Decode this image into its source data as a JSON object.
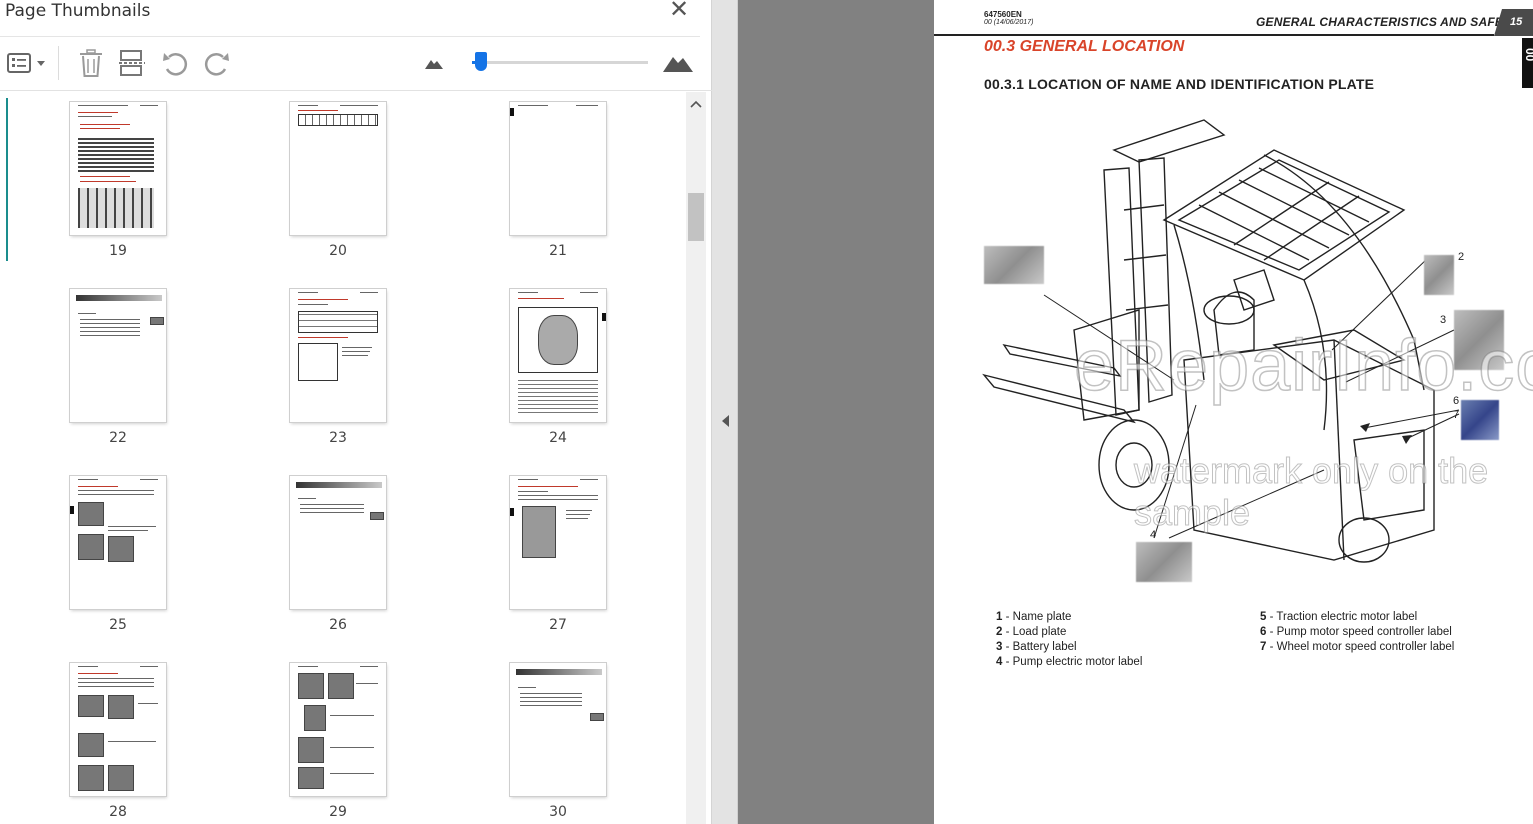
{
  "panel": {
    "title": "Page Thumbnails",
    "close_glyph": "✕"
  },
  "toolbar": {
    "options_icon": "list-options-icon",
    "delete_icon": "trash-icon",
    "extract_icon": "extract-pages-icon",
    "undo_icon": "rotate-ccw-icon",
    "redo_icon": "rotate-cw-icon",
    "zoom_out_icon": "small-mountain-icon",
    "zoom_in_icon": "large-mountain-icon",
    "zoom_level": 0.05
  },
  "thumbnails": [
    {
      "label": "19"
    },
    {
      "label": "20"
    },
    {
      "label": "21"
    },
    {
      "label": "22"
    },
    {
      "label": "23"
    },
    {
      "label": "24"
    },
    {
      "label": "25"
    },
    {
      "label": "26"
    },
    {
      "label": "27"
    },
    {
      "label": "28"
    },
    {
      "label": "29"
    },
    {
      "label": "30"
    }
  ],
  "document": {
    "code": "647560EN",
    "date": "00 (14/06/2017)",
    "section": "GENERAL CHARACTERISTICS AND SAFETY",
    "page_number": "15",
    "side_tab": "00",
    "heading": "00.3   GENERAL LOCATION",
    "subheading": "00.3.1    LOCATION OF NAME AND IDENTIFICATION PLATE",
    "callouts": [
      "2",
      "3",
      "6",
      "7",
      "4"
    ],
    "legend_left": [
      {
        "num": "1",
        "text": "Name plate"
      },
      {
        "num": "2",
        "text": "Load plate"
      },
      {
        "num": "3",
        "text": "Battery label"
      },
      {
        "num": "4",
        "text": "Pump electric motor label"
      }
    ],
    "legend_right": [
      {
        "num": "5",
        "text": "Traction electric motor label"
      },
      {
        "num": "6",
        "text": "Pump motor speed controller label"
      },
      {
        "num": "7",
        "text": "Wheel motor speed controller label"
      }
    ],
    "watermark_main": "eRepairInfo.com",
    "watermark_sub": "watermark only on the sample"
  }
}
